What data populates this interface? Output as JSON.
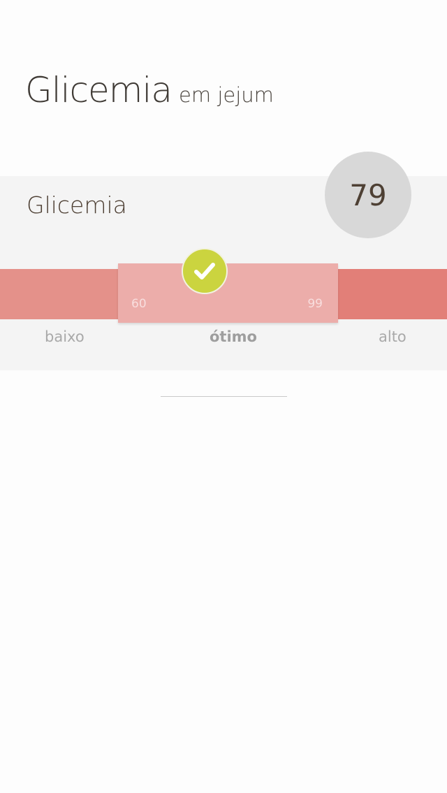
{
  "header": {
    "title": "Glicemia",
    "subtitle": "em jejum"
  },
  "card": {
    "label": "Glicemia",
    "value": "79",
    "range": {
      "min": "60",
      "max": "99"
    },
    "zones": {
      "low": "baixo",
      "optimal": "ótimo",
      "high": "alto"
    },
    "status_icon": "check-icon",
    "colors": {
      "low": "#e4918a",
      "optimal": "#ecadaa",
      "high": "#e27f78",
      "check": "#cbd43f"
    }
  }
}
